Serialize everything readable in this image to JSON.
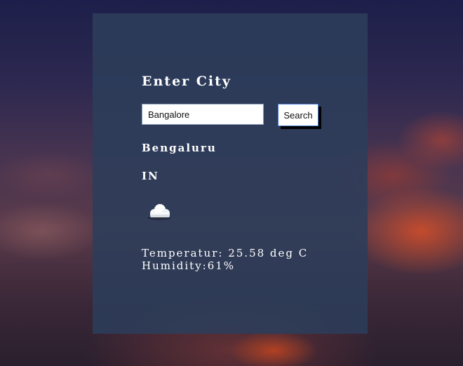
{
  "form": {
    "heading": "Enter City",
    "input_value": "Bangalore",
    "search_label": "Search"
  },
  "result": {
    "city": "Bengaluru",
    "country": "IN",
    "weather_icon": "cloud-icon",
    "temperature_text": "Temperatur: 25.58 deg C",
    "humidity_text": "Humidity:61%"
  }
}
